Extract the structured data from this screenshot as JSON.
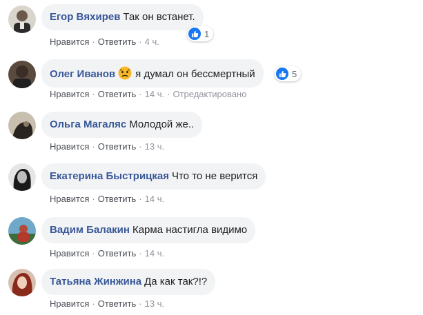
{
  "comments": [
    {
      "author": "Егор Вяхирев",
      "text": "Так он встанет.",
      "reactions": "1",
      "like": "Нравится",
      "reply": "Ответить",
      "time": "4 ч.",
      "edited": ""
    },
    {
      "author": "Олег Иванов",
      "text": "я думал он бессмертный",
      "reactions": "5",
      "like": "Нравится",
      "reply": "Ответить",
      "time": "14 ч.",
      "edited": "Отредактировано",
      "emoji": "sad-face-icon"
    },
    {
      "author": "Ольга Магаляс",
      "text": "Молодой же..",
      "like": "Нравится",
      "reply": "Ответить",
      "time": "13 ч."
    },
    {
      "author": "Екатерина Быстрицкая",
      "text": "Что то не верится",
      "like": "Нравится",
      "reply": "Ответить",
      "time": "14 ч."
    },
    {
      "author": "Вадим Балакин",
      "text": "Карма настигла видимо",
      "like": "Нравится",
      "reply": "Ответить",
      "time": "14 ч."
    },
    {
      "author": "Татьяна Жинжина",
      "text": "Да как так?!?",
      "like": "Нравится",
      "reply": "Ответить",
      "time": "13 ч."
    }
  ],
  "colors": {
    "author": "#385898",
    "bubble": "#f2f3f5",
    "like_badge": "#1877f2"
  },
  "separator": "·"
}
